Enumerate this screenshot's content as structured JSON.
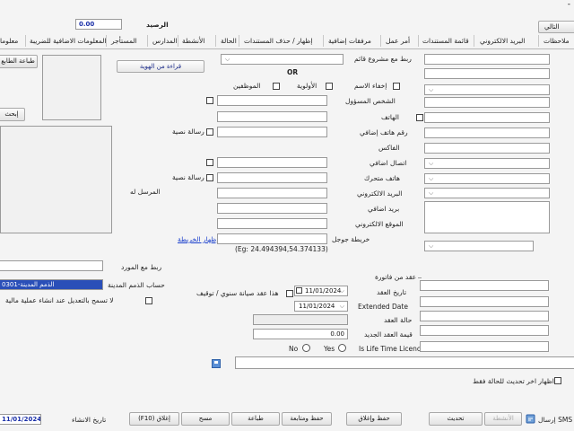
{
  "window": {
    "close_glyph": "-"
  },
  "header": {
    "balance_label": "الرصيد",
    "balance_value": "0.00",
    "next_label": "التالي"
  },
  "tabs": [
    "ملاحظات",
    "البريد الالكتروني",
    "قائمة المستندات",
    "أمر عمل",
    "مرفقات إضافية",
    "إظهار / حذف المستندات",
    "الحالة",
    "الأنشطة",
    "المدارس",
    "المستأجر",
    "المعلومات الاضافية للضريبة",
    "معلوما"
  ],
  "top_section": {
    "link_project_label": "ربط مع مشروع قائم",
    "or_label": "OR",
    "read_id_button": "قراءة من الهوية",
    "hide_name_label": "إخفاء الاسم",
    "priority_label": "الأولوية",
    "employees_label": "الموظفين",
    "responsible_person_label": "الشخص المسؤول",
    "phone_label": "الهاتف",
    "extra_phone_label": "رقم هاتف إضافي",
    "fax_label": "الفاكس",
    "extra_contact_label": "اتصال اضافي",
    "mobile_label": "هاتف متحرك",
    "email_label": "البريد الالكتروني",
    "extra_mail_label": "بريد اضافي",
    "website_label": "الموقع الالكتروني",
    "google_map_label": "خريطة جوجل",
    "show_map_link": "إظهار الخريطة",
    "map_example": "(Eg: 24.494394,54.374133)",
    "text_message_label": "رسالة نصية",
    "sent_to_label": "المرسل له"
  },
  "left_panel": {
    "print_label_button": "طباعة الطابع",
    "search_button": "إبحث"
  },
  "supplier": {
    "link_supplier_label": "ربط مع المورد",
    "receivables_account_label": "حساب الذمم المدينة",
    "receivables_account_value": "0301-الذمم المدينة",
    "no_edit_label": "لا تسمح بالتعديل عند انشاء عملية مالية"
  },
  "contract": {
    "invoice_contract_label": "عقد من فاتورة",
    "contract_date_label": "تاريخ العقد",
    "contract_date_value": "11/01/2024",
    "extended_date_label": "Extended Date",
    "extended_date_value": "11/01/2024",
    "contract_status_label": "حالة العقد",
    "new_contract_value_label": "قيمة العقد الجديد",
    "new_contract_value": "0.00",
    "lifetime_label": "Is Life Time Licence",
    "yes_label": "Yes",
    "no_label": "No",
    "annual_maintenance_label": "هذا عقد صيانة سنوي / توقيف"
  },
  "status_update": {
    "label": "اظهار اخر تحديث للحالة فقط"
  },
  "footer": {
    "creation_date_label": "تاريخ الانشاء",
    "creation_date_value": "11/01/2024",
    "close_f10": "(F10) إغلاق",
    "clear": "مسح",
    "print": "طباعة",
    "save_follow": "حفظ ومتابعة",
    "save_close": "حفظ وإغلاق",
    "update": "تحديث",
    "activities": "الأنشطة",
    "sms": "إرسال SMS"
  }
}
